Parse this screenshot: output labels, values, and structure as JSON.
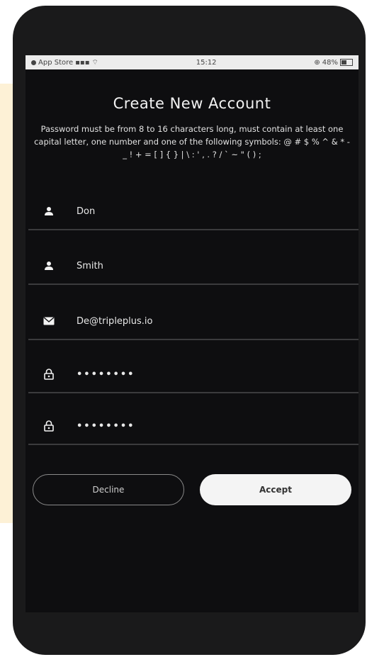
{
  "status_bar": {
    "carrier": "App Store",
    "time": "15:12",
    "battery": "48%"
  },
  "form": {
    "title": "Create New Account",
    "description": "Password must be from 8 to 16 characters long, must contain at least one capital letter, one number and one of the following symbols: @ # $ % ^ & * - _ ! + = [ ] { } | \\ : ' , . ? / ` ~ \" ( ) ;",
    "fields": [
      {
        "icon": "user-icon",
        "value": "Don"
      },
      {
        "icon": "user-icon",
        "value": "Smith"
      },
      {
        "icon": "email-icon",
        "value": "De@tripleplus.io"
      },
      {
        "icon": "lock-icon",
        "value": "••••••••"
      },
      {
        "icon": "lock-icon",
        "value": "••••••••"
      }
    ]
  },
  "buttons": {
    "decline": "Decline",
    "accept": "Accept"
  }
}
